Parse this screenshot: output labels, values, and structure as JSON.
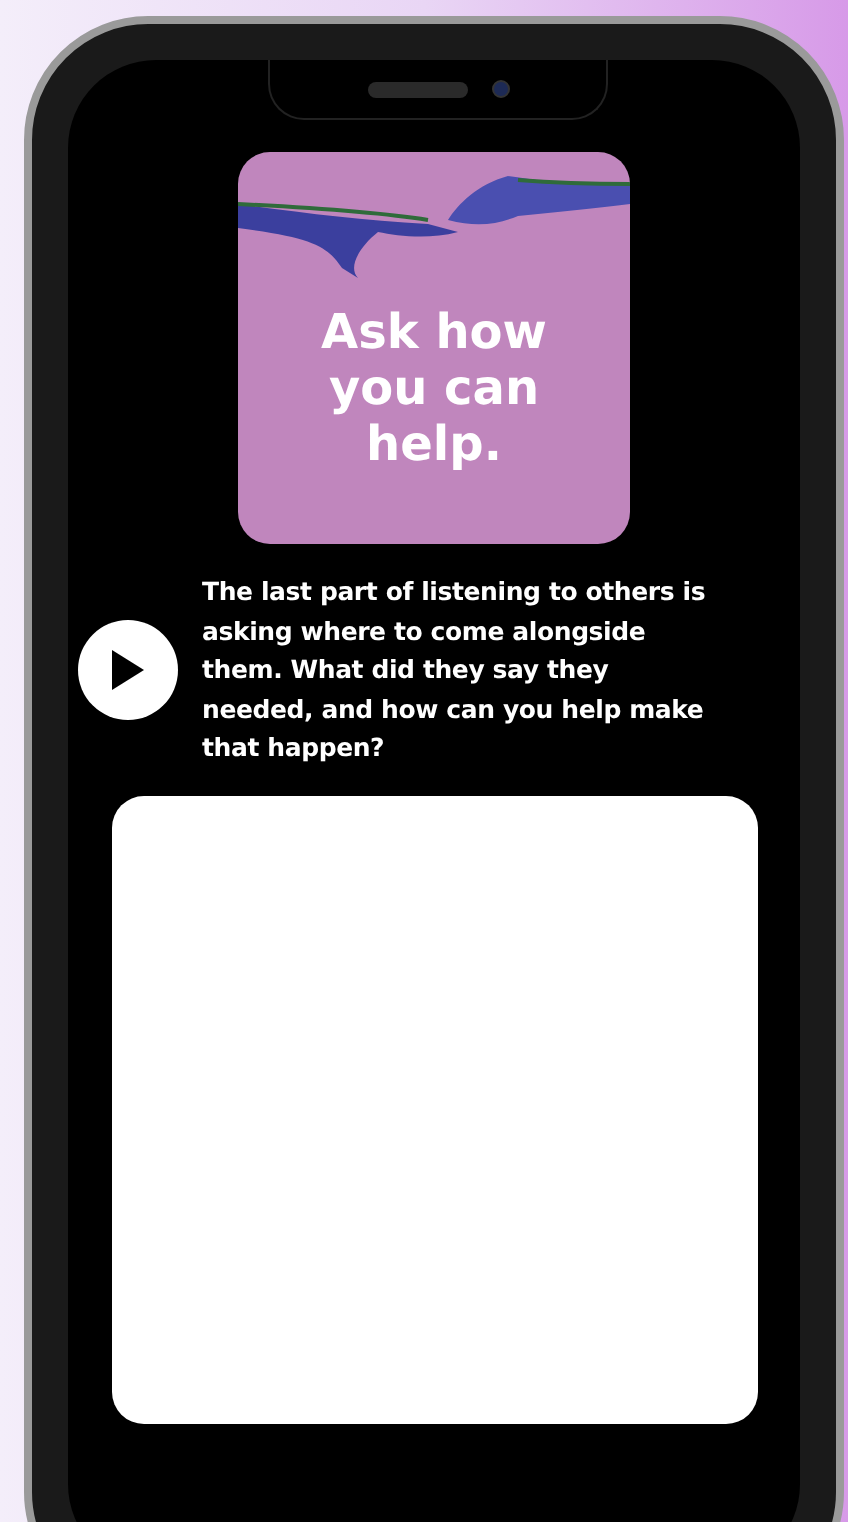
{
  "artwork": {
    "title": "Ask how you can help."
  },
  "description": "The last part of listening to others is asking where to come alongside them. What did they say they needed, and how can you help make that happen?"
}
